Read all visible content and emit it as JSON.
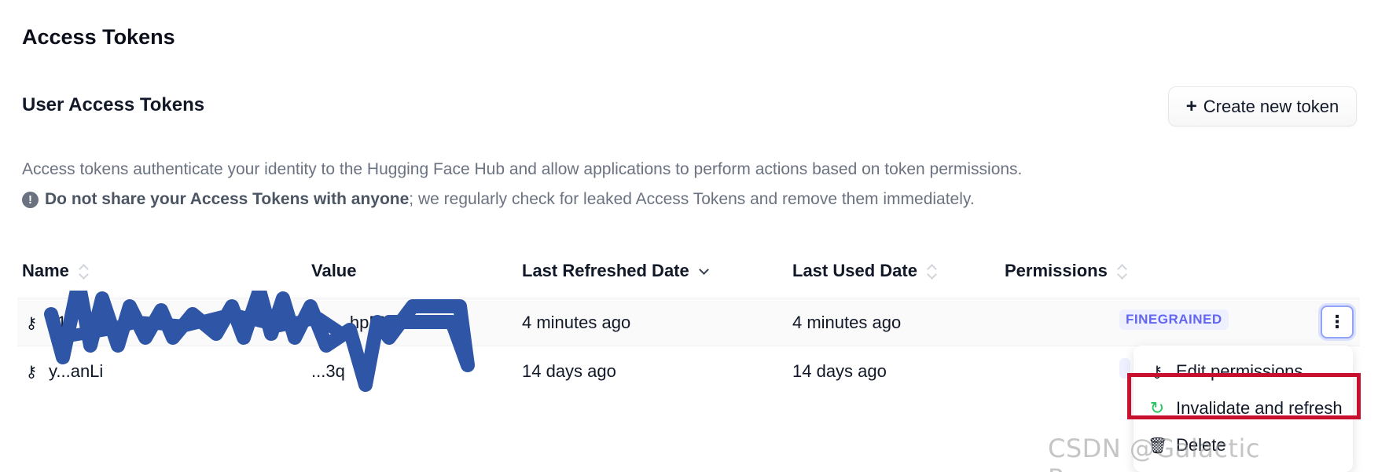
{
  "page_title": "Access Tokens",
  "section_title": "User Access Tokens",
  "create_button_label": "Create new token",
  "create_button_plus": "+",
  "description": "Access tokens authenticate your identity to the Hugging Face Hub and allow applications to perform actions based on token permissions.",
  "warning": {
    "icon": "!",
    "bold_prefix": "Do not share your ",
    "bold_strong": "Access Tokens",
    "bold_suffix": " with anyone",
    "rest": "; we regularly check for leaked Access Tokens and remove them immediately."
  },
  "table": {
    "headers": {
      "name": "Name",
      "value": "Value",
      "last_refreshed": "Last Refreshed Date",
      "last_used": "Last Used Date",
      "permissions": "Permissions"
    },
    "rows": [
      {
        "name": "111",
        "value": "hf_...hpEX",
        "last_refreshed": "4 minutes ago",
        "last_used": "4 minutes ago",
        "permission": "FINEGRAINED"
      },
      {
        "name": "y...anLi",
        "value": "...3q",
        "last_refreshed": "14 days ago",
        "last_used": "14 days ago",
        "permission": "F"
      }
    ]
  },
  "icons": {
    "key": "key-icon",
    "kebab": "more-vertical-icon",
    "refresh": "refresh-icon",
    "trash": "trash-icon",
    "sort": "sort-icon"
  },
  "menu": {
    "edit_label": "Edit permissions",
    "refresh_label": "Invalidate and refresh",
    "delete_label": "Delete"
  },
  "colors": {
    "badge_text": "#6366f1",
    "badge_bg": "#eef0ff",
    "highlight": "#c8102e",
    "refresh_icon": "#22c55e",
    "scribble": "#2e55a6"
  },
  "watermark": "CSDN @Galactic Romance."
}
